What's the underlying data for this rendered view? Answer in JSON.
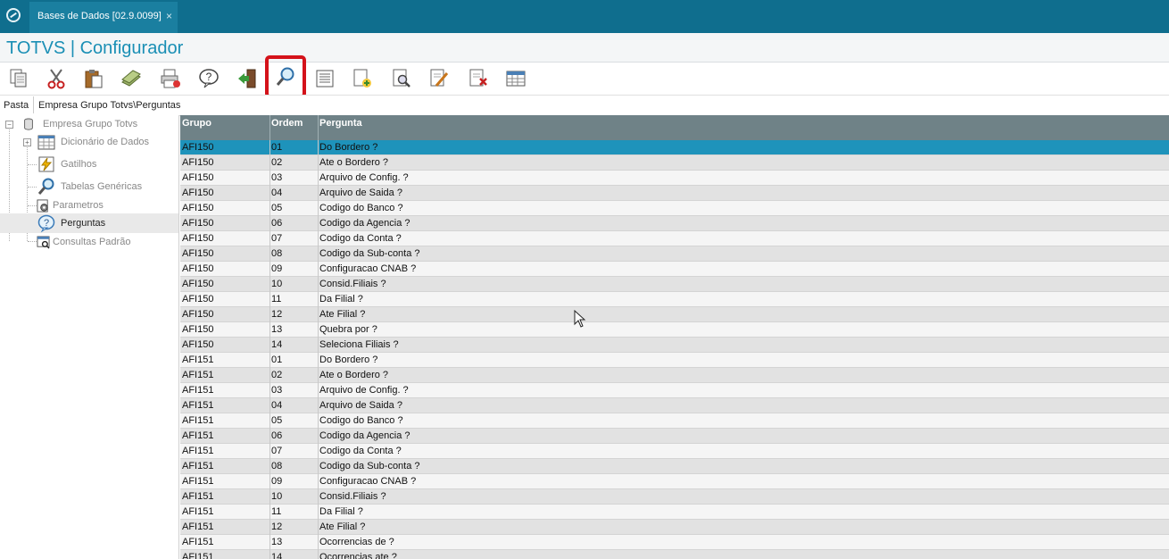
{
  "tab": {
    "title": "Bases de Dados [02.9.0099]",
    "close": "×"
  },
  "app": {
    "title": "TOTVS | Configurador"
  },
  "toolbar": {
    "buttons": [
      {
        "name": "copy-icon"
      },
      {
        "name": "cut-icon"
      },
      {
        "name": "paste-icon"
      },
      {
        "name": "money-icon"
      },
      {
        "name": "print-icon"
      },
      {
        "name": "help-icon"
      },
      {
        "name": "exit-icon"
      },
      {
        "name": "search-icon",
        "highlighted": true
      },
      {
        "name": "list-icon"
      },
      {
        "name": "add-icon"
      },
      {
        "name": "preview-icon"
      },
      {
        "name": "edit-icon"
      },
      {
        "name": "delete-icon"
      },
      {
        "name": "table-icon"
      }
    ],
    "highlight_color": "#d4121a"
  },
  "path": {
    "label": "Pasta",
    "value": "Empresa Grupo Totvs\\Perguntas"
  },
  "tree": {
    "root": "Empresa Grupo Totvs",
    "items": [
      {
        "label": "Dicionário de Dados",
        "icon": "table-icon"
      },
      {
        "label": "Gatilhos",
        "icon": "lightning-icon"
      },
      {
        "label": "Tabelas Genéricas",
        "icon": "magnifier-icon"
      },
      {
        "label": "Parametros",
        "icon": "gear-icon"
      },
      {
        "label": "Perguntas",
        "icon": "question-icon",
        "selected": true
      },
      {
        "label": "Consultas Padrão",
        "icon": "query-icon"
      }
    ]
  },
  "grid": {
    "columns": [
      "Grupo",
      "Ordem",
      "Pergunta"
    ],
    "selected_color": "#1e93bb",
    "rows": [
      [
        "AFI150",
        "01",
        "Do Bordero ?"
      ],
      [
        "AFI150",
        "02",
        "Ate o Bordero ?"
      ],
      [
        "AFI150",
        "03",
        "Arquivo de Config. ?"
      ],
      [
        "AFI150",
        "04",
        "Arquivo de Saida ?"
      ],
      [
        "AFI150",
        "05",
        "Codigo do Banco ?"
      ],
      [
        "AFI150",
        "06",
        "Codigo da Agencia ?"
      ],
      [
        "AFI150",
        "07",
        "Codigo da Conta ?"
      ],
      [
        "AFI150",
        "08",
        "Codigo da Sub-conta ?"
      ],
      [
        "AFI150",
        "09",
        "Configuracao CNAB ?"
      ],
      [
        "AFI150",
        "10",
        "Consid.Filiais ?"
      ],
      [
        "AFI150",
        "11",
        "Da Filial ?"
      ],
      [
        "AFI150",
        "12",
        "Ate Filial ?"
      ],
      [
        "AFI150",
        "13",
        "Quebra por ?"
      ],
      [
        "AFI150",
        "14",
        "Seleciona Filiais ?"
      ],
      [
        "AFI151",
        "01",
        "Do Bordero ?"
      ],
      [
        "AFI151",
        "02",
        "Ate o Bordero ?"
      ],
      [
        "AFI151",
        "03",
        "Arquivo de Config. ?"
      ],
      [
        "AFI151",
        "04",
        "Arquivo de Saida ?"
      ],
      [
        "AFI151",
        "05",
        "Codigo do Banco ?"
      ],
      [
        "AFI151",
        "06",
        "Codigo da Agencia ?"
      ],
      [
        "AFI151",
        "07",
        "Codigo da Conta ?"
      ],
      [
        "AFI151",
        "08",
        "Codigo da Sub-conta ?"
      ],
      [
        "AFI151",
        "09",
        "Configuracao CNAB ?"
      ],
      [
        "AFI151",
        "10",
        "Consid.Filiais ?"
      ],
      [
        "AFI151",
        "11",
        "Da Filial ?"
      ],
      [
        "AFI151",
        "12",
        "Ate Filial ?"
      ],
      [
        "AFI151",
        "13",
        "Ocorrencias de ?"
      ],
      [
        "AFI151",
        "14",
        "Ocorrencias ate ?"
      ]
    ]
  }
}
